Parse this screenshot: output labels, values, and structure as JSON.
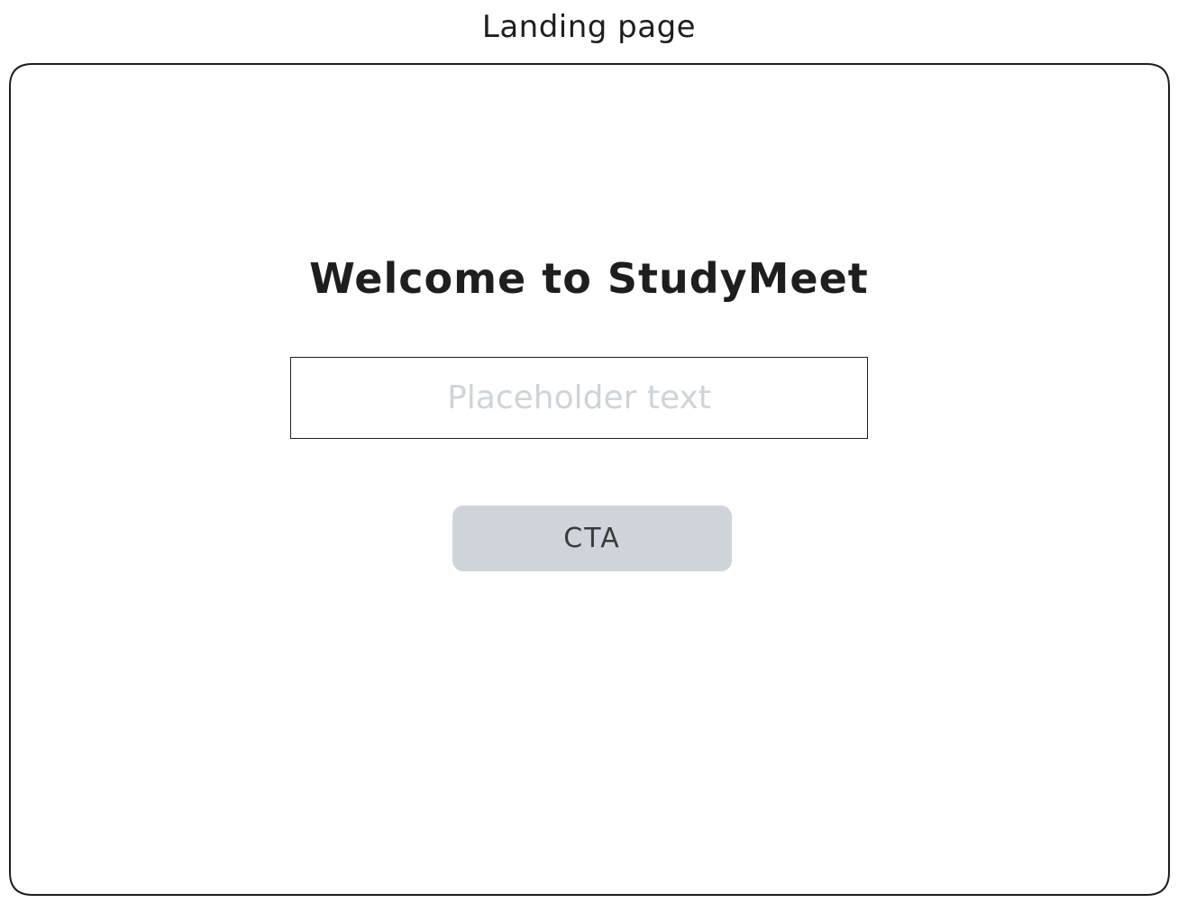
{
  "frame": {
    "title": "Landing page"
  },
  "landing": {
    "heading": "Welcome to StudyMeet",
    "input": {
      "value": "",
      "placeholder": "Placeholder text"
    },
    "cta_label": "CTA"
  },
  "colors": {
    "stroke": "#1e1e1e",
    "placeholder": "#ced4da",
    "button_fill": "#ced4da",
    "button_text": "#3a3a3a",
    "background": "#ffffff"
  }
}
